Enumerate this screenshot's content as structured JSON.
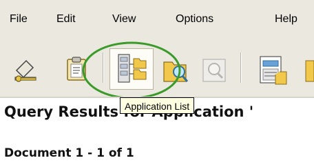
{
  "menu": {
    "items": [
      {
        "label": "File"
      },
      {
        "label": "Edit"
      },
      {
        "label": "View"
      },
      {
        "label": "Options"
      },
      {
        "label": "Help"
      }
    ]
  },
  "toolbar": {
    "buttons": [
      {
        "icon": "key-login-icon"
      },
      {
        "icon": "clipboard-icon"
      },
      {
        "icon": "application-list-icon"
      },
      {
        "icon": "search-icon"
      },
      {
        "icon": "search-disabled-icon"
      },
      {
        "icon": "document-form-icon"
      }
    ],
    "tooltip": "Application List"
  },
  "main": {
    "title": "Query Results for Application '",
    "document_line": "Document 1 - 1 of 1"
  },
  "colors": {
    "chrome": "#ebe8df",
    "highlight_ring": "#3a9a2a",
    "tooltip_bg": "#ffffe1"
  }
}
